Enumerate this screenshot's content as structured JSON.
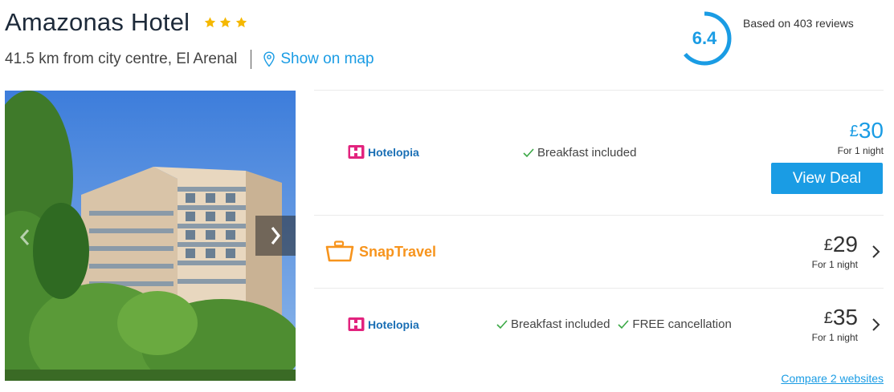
{
  "hotel": {
    "name": "Amazonas Hotel",
    "star_count": 3,
    "distance": "41.5 km from city centre, El Arenal",
    "map_link": "Show on map"
  },
  "rating": {
    "score": "6.4",
    "score_fraction": 0.64,
    "reviews": "Based on 403 reviews"
  },
  "deals": [
    {
      "provider": "Hotelopia",
      "features": [
        "Breakfast included"
      ],
      "currency": "£",
      "price": "30",
      "per_night": "For 1 night",
      "cta": "View Deal",
      "highlighted": true
    },
    {
      "provider": "SnapTravel",
      "features": [],
      "currency": "£",
      "price": "29",
      "per_night": "For 1 night",
      "highlighted": false
    },
    {
      "provider": "Hotelopia",
      "features": [
        "Breakfast included",
        "FREE cancellation"
      ],
      "currency": "£",
      "price": "35",
      "per_night": "For 1 night",
      "highlighted": false
    }
  ],
  "compare_link": "Compare 2 websites",
  "colors": {
    "accent": "#1a9ce4",
    "star": "#f5b800",
    "check": "#3aa845",
    "snaptravel": "#f7941d",
    "hotelopia_text": "#1a6fb5",
    "hotelopia_logo": "#e2237e"
  }
}
